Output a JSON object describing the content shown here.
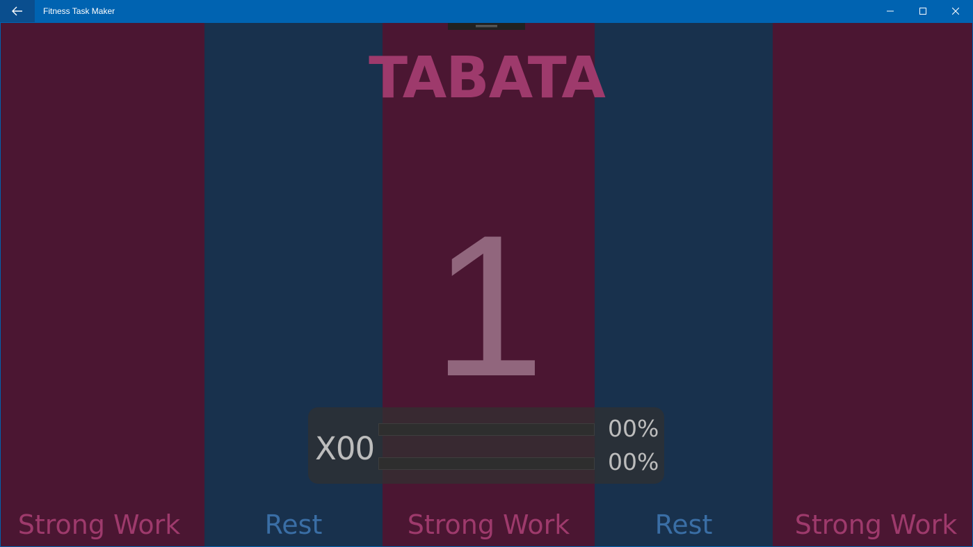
{
  "window": {
    "title": "Fitness Task Maker",
    "back_icon": "arrow-left-icon",
    "minimize_icon": "minimize-icon",
    "maximize_icon": "maximize-icon",
    "close_icon": "close-icon",
    "titlebar_color": "#0063B1"
  },
  "workout": {
    "title": "TABATA",
    "counter": "1",
    "round_count": "X00",
    "progress": [
      {
        "label": "00%",
        "fraction": 0
      },
      {
        "label": "00%",
        "fraction": 0
      }
    ]
  },
  "phases": [
    {
      "label": "Strong Work",
      "kind": "work"
    },
    {
      "label": "Rest",
      "kind": "rest"
    },
    {
      "label": "Strong Work",
      "kind": "work"
    },
    {
      "label": "Rest",
      "kind": "rest"
    },
    {
      "label": "Strong Work",
      "kind": "work"
    }
  ],
  "colors": {
    "work_bg": "#4B1632",
    "rest_bg": "#18314D",
    "work_text": "#9E3A6C",
    "rest_text": "#3A6EA5",
    "counter_text": "#91667D"
  }
}
